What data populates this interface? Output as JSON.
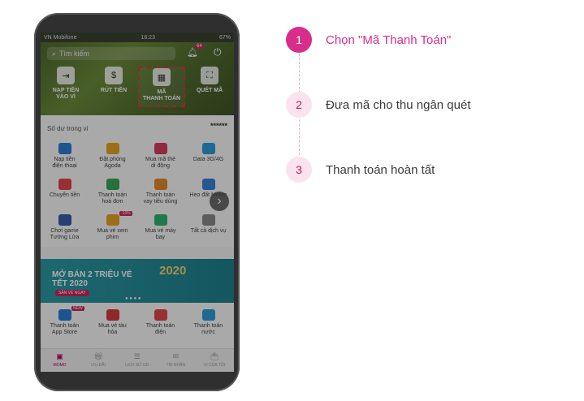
{
  "phone": {
    "statusbar": {
      "carrier": "VN Mobifone",
      "time": "16:23",
      "battery": "67%"
    },
    "search_placeholder": "Tìm kiếm",
    "notification_count": "64",
    "quick_actions": [
      {
        "label": "NẠP TIỀN\nVÀO VÍ",
        "icon": "deposit-icon"
      },
      {
        "label": "RÚT TIỀN",
        "icon": "withdraw-icon"
      },
      {
        "label": "MÃ\nTHANH TOÁN",
        "icon": "qr-code-icon"
      },
      {
        "label": "QUÉT MÃ",
        "icon": "scan-icon"
      }
    ],
    "balance_label": "Số dư trong ví",
    "balance_value": "******",
    "services_grid": [
      {
        "label": "Nạp tiền\nđiện thoại",
        "color": "#2b7bd6"
      },
      {
        "label": "Đặt phòng\nAgoda",
        "color": "#e6a322"
      },
      {
        "label": "Mua mã thẻ\ndi động",
        "color": "#d63b5a"
      },
      {
        "label": "Data 3G/4G",
        "color": "#2b9bd6"
      },
      {
        "label": "Chuyển tiền",
        "color": "#e04848"
      },
      {
        "label": "Thanh toán\nhoá đơn",
        "color": "#3aa552"
      },
      {
        "label": "Thanh toán\nvay tiêu dùng",
        "color": "#e08a2b"
      },
      {
        "label": "Heo đất MoMo",
        "color": "#3a7fd6"
      },
      {
        "label": "Chơi game\nTướng Lửa",
        "color": "#3a5ca8"
      },
      {
        "label": "Mua vé xem\nphim",
        "color": "#e6a322"
      },
      {
        "label": "Mua vé máy\nbay",
        "color": "#2bb36b"
      },
      {
        "label": "Tất cả dịch vụ",
        "color": "#888888"
      }
    ],
    "promo_badge": "-10%",
    "banner": {
      "title": "MỞ BÁN 2 TRIỆU VÉ\nTẾT 2020",
      "button": "SĂN VÉ NGAY",
      "year_art": "2020"
    },
    "services_bottom": [
      {
        "label": "Thanh toán\nApp Store",
        "color": "#2b7bd6",
        "badge": "NEW"
      },
      {
        "label": "Mua vé tàu\nhỏa",
        "color": "#d63b3b"
      },
      {
        "label": "Thanh toán\nđiện",
        "color": "#e04848"
      },
      {
        "label": "Thanh toán\nnước",
        "color": "#2b9bd6"
      }
    ],
    "tabs": [
      {
        "label": "MOMO",
        "icon": "home-icon"
      },
      {
        "label": "ƯU ĐÃI",
        "icon": "gift-icon"
      },
      {
        "label": "LỊCH SỬ GD",
        "icon": "history-icon"
      },
      {
        "label": "TIN NHẮN",
        "icon": "chat-icon"
      },
      {
        "label": "VÍ CỦA TÔI",
        "icon": "wallet-icon"
      }
    ],
    "next_arrow": "›"
  },
  "steps": [
    {
      "number": "1",
      "text": "Chọn \"Mã Thanh Toán\"",
      "active": true
    },
    {
      "number": "2",
      "text": "Đưa mã cho thu ngân quét",
      "active": false
    },
    {
      "number": "3",
      "text": "Thanh toán hoàn tất",
      "active": false
    }
  ]
}
